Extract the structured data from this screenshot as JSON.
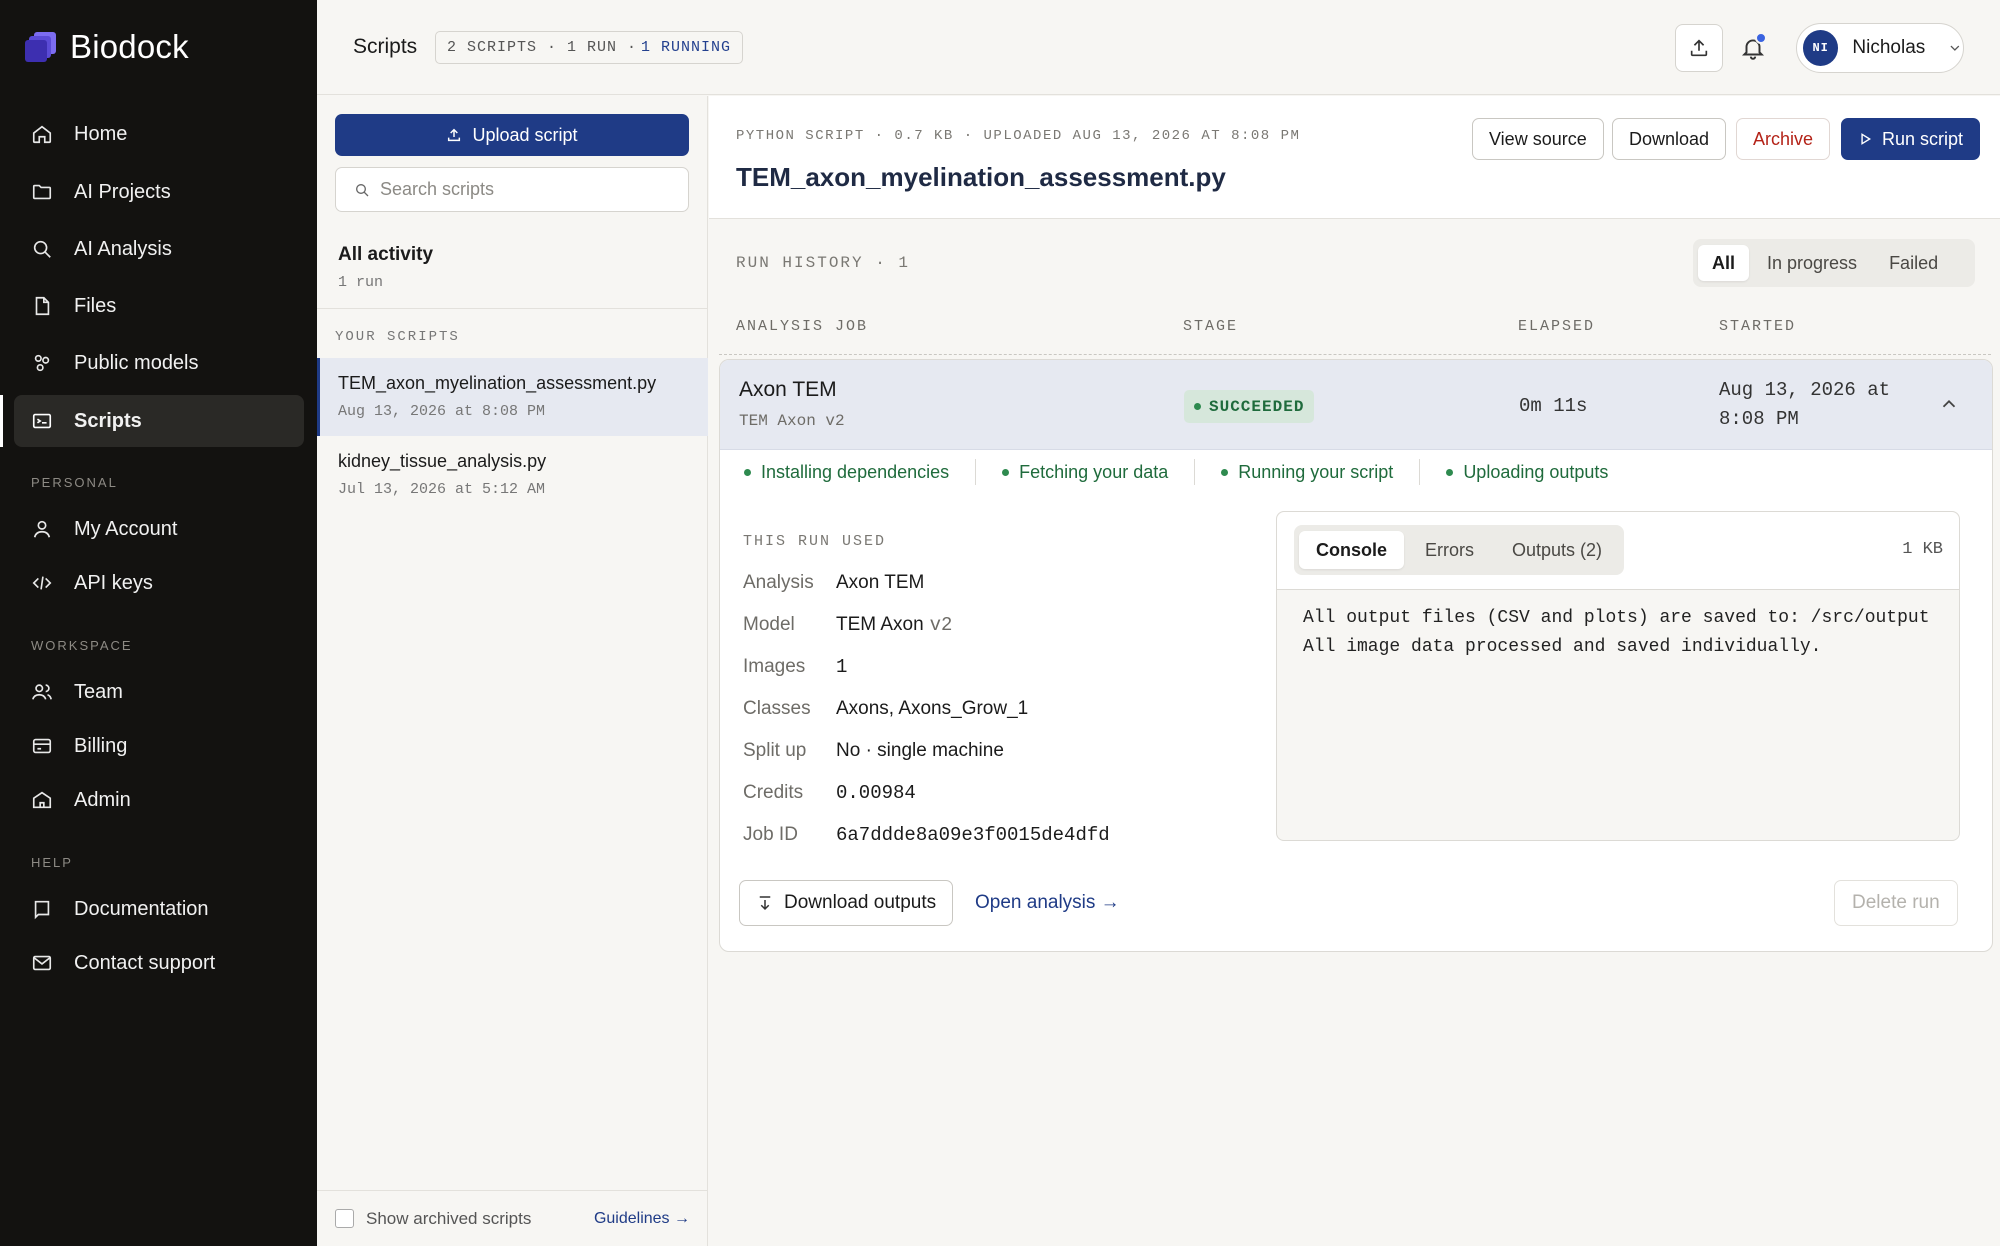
{
  "brand": {
    "name": "Biodock",
    "accent": "#1f3b86"
  },
  "sidebar": {
    "items": [
      {
        "label": "Home",
        "icon": "home-icon"
      },
      {
        "label": "AI Projects",
        "icon": "folder-icon"
      },
      {
        "label": "AI Analysis",
        "icon": "search-icon"
      },
      {
        "label": "Files",
        "icon": "file-icon"
      },
      {
        "label": "Public models",
        "icon": "models-icon"
      },
      {
        "label": "Scripts",
        "icon": "scripts-icon",
        "active": true
      }
    ],
    "personal_label": "PERSONAL",
    "personal": [
      {
        "label": "My Account",
        "icon": "user-icon"
      },
      {
        "label": "API keys",
        "icon": "code-icon"
      }
    ],
    "workspace_label": "WORKSPACE",
    "workspace": [
      {
        "label": "Team",
        "icon": "team-icon"
      },
      {
        "label": "Billing",
        "icon": "credit-card-icon"
      },
      {
        "label": "Admin",
        "icon": "bank-icon"
      }
    ],
    "help_label": "HELP",
    "help": [
      {
        "label": "Documentation",
        "icon": "book-icon"
      },
      {
        "label": "Contact support",
        "icon": "mail-icon"
      }
    ]
  },
  "topbar": {
    "title": "Scripts",
    "summary_prefix": "2 SCRIPTS · 1 RUN ·",
    "summary_running": "1 RUNNING",
    "user_initials": "NI",
    "user_name": "Nicholas"
  },
  "scripts_panel": {
    "upload_label": "Upload script",
    "search_placeholder": "Search scripts",
    "all_activity": "All activity",
    "all_activity_sub": "1 run",
    "your_scripts_label": "YOUR SCRIPTS",
    "scripts": [
      {
        "name": "TEM_axon_myelination_assessment.py",
        "date": "Aug 13, 2026 at 8:08 PM",
        "active": true
      },
      {
        "name": "kidney_tissue_analysis.py",
        "date": "Jul 13, 2026 at 5:12 AM",
        "active": false
      }
    ],
    "show_archived": "Show archived scripts",
    "guidelines": "Guidelines →"
  },
  "script_detail": {
    "meta": "PYTHON SCRIPT · 0.7 KB · UPLOADED AUG 13, 2026 AT 8:08 PM",
    "title": "TEM_axon_myelination_assessment.py",
    "actions": {
      "view_source": "View source",
      "download": "Download",
      "archive": "Archive",
      "run": "Run script"
    }
  },
  "run_history": {
    "label": "RUN HISTORY · 1",
    "filters": [
      "All",
      "In progress",
      "Failed"
    ],
    "active_filter": "All",
    "columns": {
      "job": "ANALYSIS JOB",
      "stage": "STAGE",
      "elapsed": "ELAPSED",
      "started": "STARTED"
    },
    "runs": [
      {
        "job": "Axon TEM",
        "model": "TEM Axon v2",
        "stage": "SUCCEEDED",
        "elapsed": "0m 11s",
        "started": "Aug 13, 2026 at 8:08 PM",
        "steps": [
          "Installing dependencies",
          "Fetching your data",
          "Running your script",
          "Uploading outputs"
        ],
        "used_label": "THIS RUN USED",
        "details": {
          "analysis_k": "Analysis",
          "analysis_v": "Axon TEM",
          "model_k": "Model",
          "model_v": "TEM Axon",
          "model_ver": "v2",
          "images_k": "Images",
          "images_v": "1",
          "classes_k": "Classes",
          "classes_v": "Axons, Axons_Grow_1",
          "split_k": "Split up",
          "split_v": "No · single machine",
          "credits_k": "Credits",
          "credits_v": "0.00984",
          "job_id_k": "Job ID",
          "job_id_v": "6a7ddde8a09e3f0015de4dfd"
        },
        "console": {
          "tabs": [
            "Console",
            "Errors",
            "Outputs (2)"
          ],
          "active_tab": "Console",
          "size": "1 KB",
          "lines": [
            "All output files (CSV and plots) are saved to: /src/output",
            "All image data processed and saved individually."
          ]
        },
        "download_outputs": "Download outputs",
        "open_analysis": "Open analysis →",
        "delete_run": "Delete run"
      }
    ]
  }
}
